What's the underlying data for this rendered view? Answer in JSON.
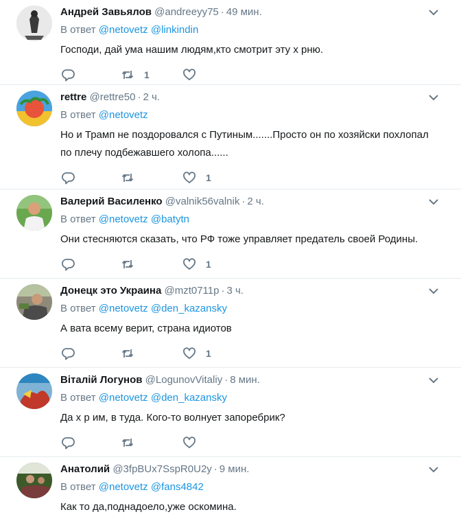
{
  "reply_prefix": "В ответ",
  "tweets": [
    {
      "name": "Андрей Завьялов",
      "handle": "@andreeyy75",
      "time": "49 мин.",
      "mentions": [
        "@netovetz",
        "@linkindin"
      ],
      "text_lines": [
        "Господи, дай ума нашим людям,кто смотрит эту х  рню."
      ],
      "retweets": "1",
      "likes": ""
    },
    {
      "name": "rettre",
      "handle": "@rettre50",
      "time": "2 ч.",
      "mentions": [
        "@netovetz"
      ],
      "text_lines": [
        "Но и Трамп не поздоровался с Путиным.......Просто он по хозяйски похлопал",
        "по плечу подбежавшего холопа......"
      ],
      "retweets": "",
      "likes": "1"
    },
    {
      "name": "Валерий Василенко",
      "handle": "@valnik56valnik",
      "time": "2 ч.",
      "mentions": [
        "@netovetz",
        "@batytn"
      ],
      "text_lines": [
        "Они стесняются сказать, что РФ тоже управляет предатель своей Родины."
      ],
      "retweets": "",
      "likes": "1"
    },
    {
      "name": "Донецк это Украина",
      "handle": "@mzt0711p",
      "time": "3 ч.",
      "mentions": [
        "@netovetz",
        "@den_kazansky"
      ],
      "text_lines": [
        "А вата всему верит, страна идиотов"
      ],
      "retweets": "",
      "likes": "1"
    },
    {
      "name": "Віталій Логунов",
      "handle": "@LogunovVitaliy",
      "time": "8 мин.",
      "mentions": [
        "@netovetz",
        "@den_kazansky"
      ],
      "text_lines": [
        "Да х  р им, в туда. Кого-то волнует запоребрик?"
      ],
      "retweets": "",
      "likes": ""
    },
    {
      "name": "Анатолий",
      "handle": "@3fpBUx7SspR0U2y",
      "time": "9 мин.",
      "mentions": [
        "@netovetz",
        "@fans4842"
      ],
      "text_lines": [
        "Как то да,поднадоело,уже оскомина."
      ],
      "retweets": "",
      "likes": ""
    }
  ]
}
